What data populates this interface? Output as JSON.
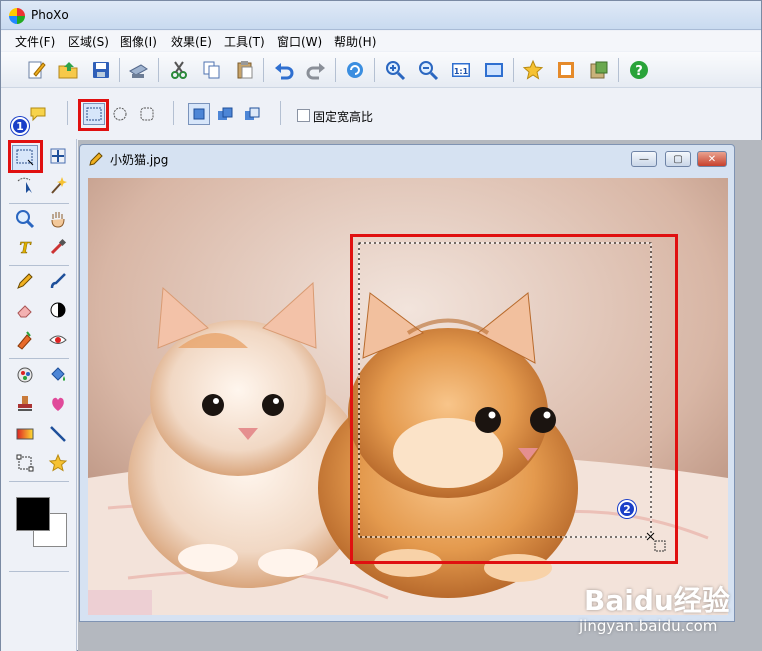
{
  "window": {
    "title": "PhoXo"
  },
  "menu": [
    {
      "label": "文件(F)"
    },
    {
      "label": "区域(S)"
    },
    {
      "label": "图像(I)"
    },
    {
      "label": "效果(E)"
    },
    {
      "label": "工具(T)"
    },
    {
      "label": "窗口(W)"
    },
    {
      "label": "帮助(H)"
    }
  ],
  "options": {
    "fixed_ratio_label": "固定宽高比"
  },
  "document": {
    "title": "小奶猫.jpg",
    "min_glyph": "—",
    "max_glyph": "▢",
    "close_glyph": "✕"
  },
  "annotations": {
    "badge1": "1",
    "badge2": "2"
  },
  "watermark": {
    "brand": "Baidu经验",
    "url": "jingyan.baidu.com"
  },
  "colors": {
    "foreground": "#000000",
    "background": "#ffffff",
    "highlight_box": "#e01010",
    "badge": "#1a3fc8"
  }
}
